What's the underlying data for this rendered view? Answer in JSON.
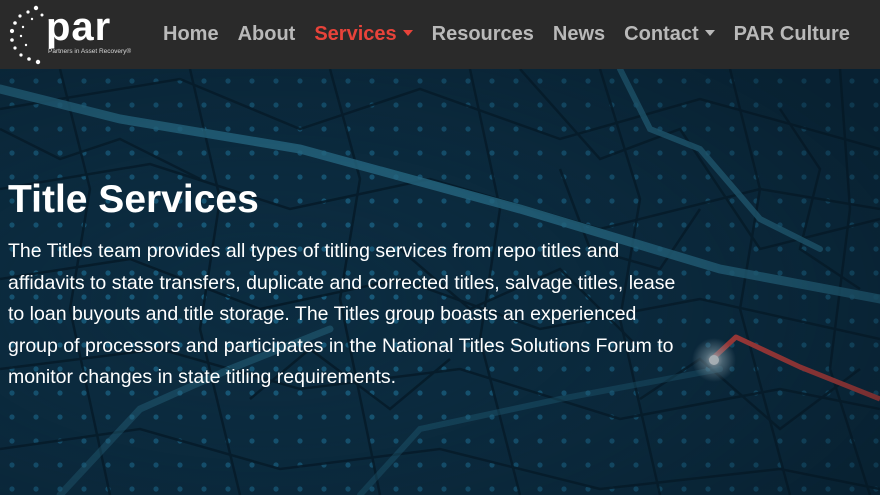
{
  "logo": {
    "word": "par",
    "tagline": "Partners in Asset Recovery®"
  },
  "nav": {
    "items": [
      {
        "label": "Home",
        "dropdown": false,
        "active": false
      },
      {
        "label": "About",
        "dropdown": false,
        "active": false
      },
      {
        "label": "Services",
        "dropdown": true,
        "active": true
      },
      {
        "label": "Resources",
        "dropdown": false,
        "active": false
      },
      {
        "label": "News",
        "dropdown": false,
        "active": false
      },
      {
        "label": "Contact",
        "dropdown": true,
        "active": false
      },
      {
        "label": "PAR Culture",
        "dropdown": false,
        "active": false
      }
    ]
  },
  "hero": {
    "title": "Title Services",
    "body": "The Titles team provides all types of titling services from repo titles and affidavits to state transfers, duplicate and corrected titles, salvage titles, lease to loan buyouts and title storage. The Titles group boasts an experienced group of processors and participates in the National Titles Solutions Forum to monitor changes in state titling requirements."
  },
  "colors": {
    "navbar_bg": "#2a2a2a",
    "nav_text": "#b9b9b9",
    "nav_active": "#e8433a",
    "hero_bg": "#0c2c40",
    "route_line": "#e8433a"
  },
  "icons": {
    "logo_mark": "dotted-circle-icon",
    "dropdown": "caret-down-icon",
    "map_background": "city-map-icon"
  }
}
